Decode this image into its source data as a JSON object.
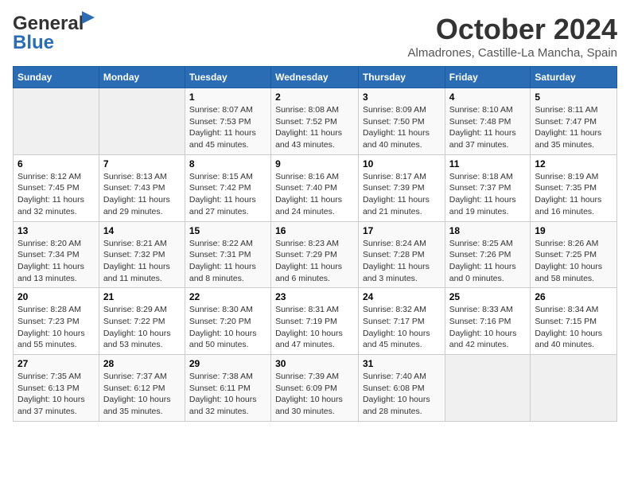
{
  "header": {
    "logo_line1": "General",
    "logo_line2": "Blue",
    "month": "October 2024",
    "location": "Almadrones, Castille-La Mancha, Spain"
  },
  "weekdays": [
    "Sunday",
    "Monday",
    "Tuesday",
    "Wednesday",
    "Thursday",
    "Friday",
    "Saturday"
  ],
  "weeks": [
    [
      {
        "day": "",
        "info": ""
      },
      {
        "day": "",
        "info": ""
      },
      {
        "day": "1",
        "info": "Sunrise: 8:07 AM\nSunset: 7:53 PM\nDaylight: 11 hours and 45 minutes."
      },
      {
        "day": "2",
        "info": "Sunrise: 8:08 AM\nSunset: 7:52 PM\nDaylight: 11 hours and 43 minutes."
      },
      {
        "day": "3",
        "info": "Sunrise: 8:09 AM\nSunset: 7:50 PM\nDaylight: 11 hours and 40 minutes."
      },
      {
        "day": "4",
        "info": "Sunrise: 8:10 AM\nSunset: 7:48 PM\nDaylight: 11 hours and 37 minutes."
      },
      {
        "day": "5",
        "info": "Sunrise: 8:11 AM\nSunset: 7:47 PM\nDaylight: 11 hours and 35 minutes."
      }
    ],
    [
      {
        "day": "6",
        "info": "Sunrise: 8:12 AM\nSunset: 7:45 PM\nDaylight: 11 hours and 32 minutes."
      },
      {
        "day": "7",
        "info": "Sunrise: 8:13 AM\nSunset: 7:43 PM\nDaylight: 11 hours and 29 minutes."
      },
      {
        "day": "8",
        "info": "Sunrise: 8:15 AM\nSunset: 7:42 PM\nDaylight: 11 hours and 27 minutes."
      },
      {
        "day": "9",
        "info": "Sunrise: 8:16 AM\nSunset: 7:40 PM\nDaylight: 11 hours and 24 minutes."
      },
      {
        "day": "10",
        "info": "Sunrise: 8:17 AM\nSunset: 7:39 PM\nDaylight: 11 hours and 21 minutes."
      },
      {
        "day": "11",
        "info": "Sunrise: 8:18 AM\nSunset: 7:37 PM\nDaylight: 11 hours and 19 minutes."
      },
      {
        "day": "12",
        "info": "Sunrise: 8:19 AM\nSunset: 7:35 PM\nDaylight: 11 hours and 16 minutes."
      }
    ],
    [
      {
        "day": "13",
        "info": "Sunrise: 8:20 AM\nSunset: 7:34 PM\nDaylight: 11 hours and 13 minutes."
      },
      {
        "day": "14",
        "info": "Sunrise: 8:21 AM\nSunset: 7:32 PM\nDaylight: 11 hours and 11 minutes."
      },
      {
        "day": "15",
        "info": "Sunrise: 8:22 AM\nSunset: 7:31 PM\nDaylight: 11 hours and 8 minutes."
      },
      {
        "day": "16",
        "info": "Sunrise: 8:23 AM\nSunset: 7:29 PM\nDaylight: 11 hours and 6 minutes."
      },
      {
        "day": "17",
        "info": "Sunrise: 8:24 AM\nSunset: 7:28 PM\nDaylight: 11 hours and 3 minutes."
      },
      {
        "day": "18",
        "info": "Sunrise: 8:25 AM\nSunset: 7:26 PM\nDaylight: 11 hours and 0 minutes."
      },
      {
        "day": "19",
        "info": "Sunrise: 8:26 AM\nSunset: 7:25 PM\nDaylight: 10 hours and 58 minutes."
      }
    ],
    [
      {
        "day": "20",
        "info": "Sunrise: 8:28 AM\nSunset: 7:23 PM\nDaylight: 10 hours and 55 minutes."
      },
      {
        "day": "21",
        "info": "Sunrise: 8:29 AM\nSunset: 7:22 PM\nDaylight: 10 hours and 53 minutes."
      },
      {
        "day": "22",
        "info": "Sunrise: 8:30 AM\nSunset: 7:20 PM\nDaylight: 10 hours and 50 minutes."
      },
      {
        "day": "23",
        "info": "Sunrise: 8:31 AM\nSunset: 7:19 PM\nDaylight: 10 hours and 47 minutes."
      },
      {
        "day": "24",
        "info": "Sunrise: 8:32 AM\nSunset: 7:17 PM\nDaylight: 10 hours and 45 minutes."
      },
      {
        "day": "25",
        "info": "Sunrise: 8:33 AM\nSunset: 7:16 PM\nDaylight: 10 hours and 42 minutes."
      },
      {
        "day": "26",
        "info": "Sunrise: 8:34 AM\nSunset: 7:15 PM\nDaylight: 10 hours and 40 minutes."
      }
    ],
    [
      {
        "day": "27",
        "info": "Sunrise: 7:35 AM\nSunset: 6:13 PM\nDaylight: 10 hours and 37 minutes."
      },
      {
        "day": "28",
        "info": "Sunrise: 7:37 AM\nSunset: 6:12 PM\nDaylight: 10 hours and 35 minutes."
      },
      {
        "day": "29",
        "info": "Sunrise: 7:38 AM\nSunset: 6:11 PM\nDaylight: 10 hours and 32 minutes."
      },
      {
        "day": "30",
        "info": "Sunrise: 7:39 AM\nSunset: 6:09 PM\nDaylight: 10 hours and 30 minutes."
      },
      {
        "day": "31",
        "info": "Sunrise: 7:40 AM\nSunset: 6:08 PM\nDaylight: 10 hours and 28 minutes."
      },
      {
        "day": "",
        "info": ""
      },
      {
        "day": "",
        "info": ""
      }
    ]
  ]
}
